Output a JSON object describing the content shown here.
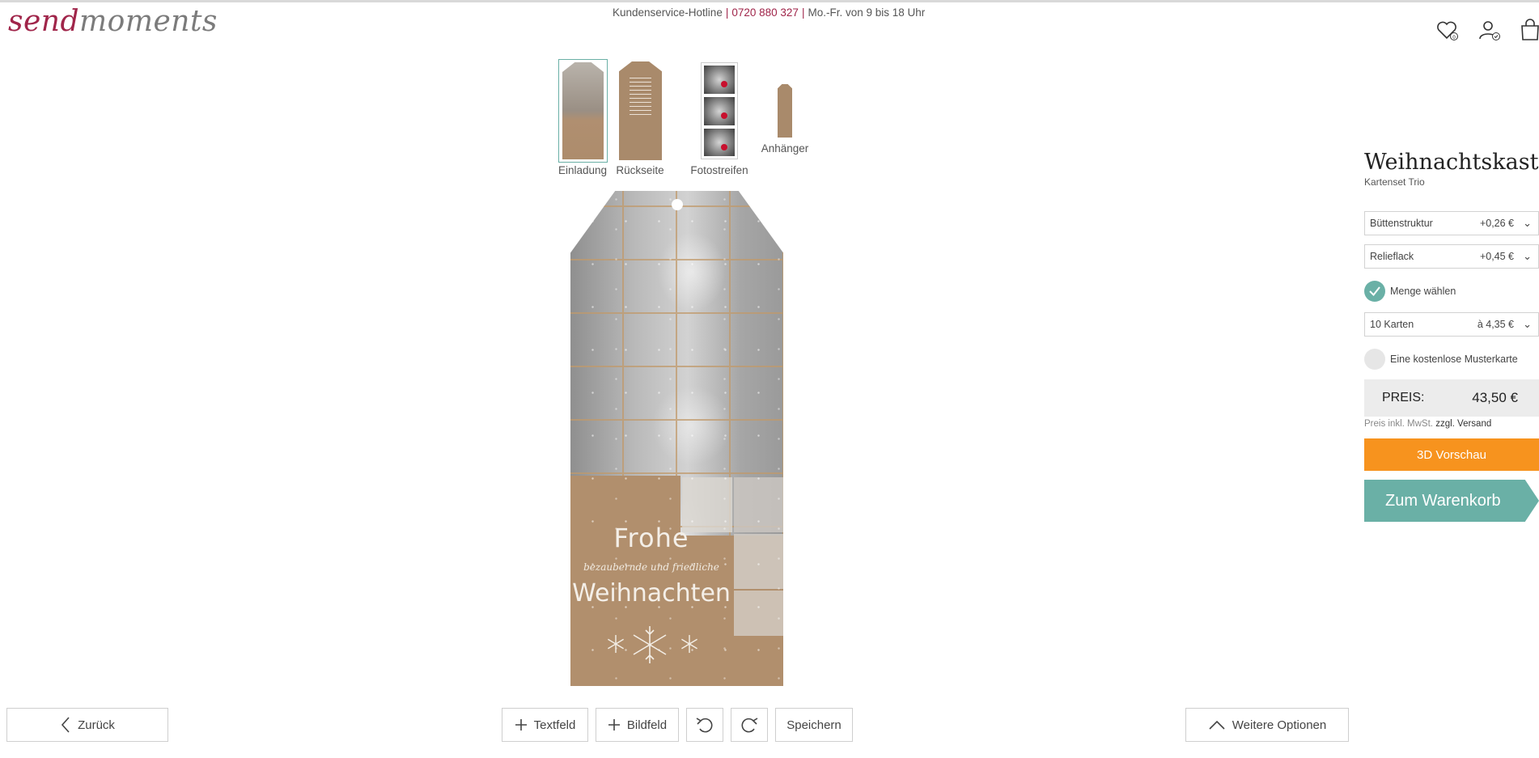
{
  "header": {
    "logo_part1": "send",
    "logo_part2": "moments",
    "hotline_label": "Kundenservice-Hotline",
    "hotline_sep": "|",
    "hotline_phone": "0720 880 327",
    "hotline_sep2": "|",
    "hotline_hours": "Mo.-Fr. von 9 bis 18 Uhr",
    "icons": [
      "heart-icon",
      "user-icon",
      "shopping-bag-icon"
    ]
  },
  "thumbnails": [
    {
      "label": "Einladung",
      "selected": true
    },
    {
      "label": "Rückseite",
      "selected": false
    },
    {
      "label": "Fotostreifen",
      "selected": false
    },
    {
      "label": "Anhänger",
      "selected": false
    }
  ],
  "card": {
    "line1": "Frohe",
    "line2": "bezaubernde und friedliche",
    "line3": "Weihnachten"
  },
  "product": {
    "title": "Weihnachtskasterl",
    "subtitle": "Kartenset Trio",
    "options": [
      {
        "label": "Büttenstruktur",
        "price": "+0,26 €"
      },
      {
        "label": "Relieflack",
        "price": "+0,45 €"
      }
    ],
    "quantity_check_label": "Menge wählen",
    "quantity": {
      "label": "10 Karten",
      "price": "à 4,35 €"
    },
    "sample_label": "Eine kostenlose Musterkarte",
    "price_label": "PREIS:",
    "price_value": "43,50 €",
    "price_note": "Preis inkl. MwSt.",
    "price_note_link": "zzgl. Versand",
    "preview_button": "3D Vorschau",
    "cart_button": "Zum Warenkorb",
    "colors": {
      "accent": "#6ab0a6",
      "orange": "#f7931e",
      "brand": "#a0254a"
    }
  },
  "toolbar": {
    "back": "Zurück",
    "textfield": "Textfeld",
    "imagefield": "Bildfeld",
    "save": "Speichern",
    "more_options": "Weitere Optionen"
  }
}
